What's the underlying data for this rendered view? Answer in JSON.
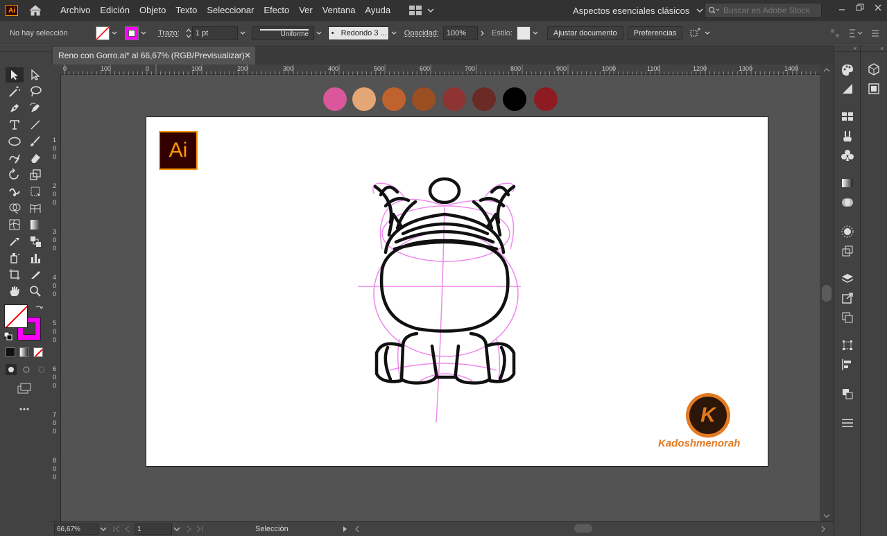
{
  "app": {
    "logo_text": "Ai"
  },
  "menu": [
    "Archivo",
    "Edición",
    "Objeto",
    "Texto",
    "Seleccionar",
    "Efecto",
    "Ver",
    "Ventana",
    "Ayuda"
  ],
  "workspace": "Aspectos esenciales clásicos",
  "stock_search": {
    "placeholder": "Buscar en Adobe Stock"
  },
  "controlbar": {
    "selection": "No hay selección",
    "stroke_label": "Trazo:",
    "stroke_weight": "1 pt",
    "profile": "Uniforme",
    "brush": "Redondo 3 ...",
    "opacity_label": "Opacidad:",
    "opacity_value": "100%",
    "style_label": "Estilo:",
    "adjust_doc": "Ajustar documento",
    "preferences": "Preferencias",
    "fill_color": "#ff00ff",
    "stroke_color": "#ff00ff"
  },
  "document": {
    "tab_title": "Reno con Gorro.ai* al 66,67% (RGB/Previsualizar)",
    "close": "✕"
  },
  "ruler_h": [
    "0",
    "100",
    "0",
    "100",
    "200",
    "300",
    "400",
    "500",
    "600",
    "700",
    "800",
    "900",
    "1000",
    "1100",
    "1200",
    "1300",
    "1400"
  ],
  "ruler_v": [
    "1",
    "0",
    "0",
    "2",
    "0",
    "0",
    "3",
    "0",
    "0",
    "4",
    "0",
    "0",
    "5",
    "0",
    "0",
    "6",
    "0",
    "0",
    "7",
    "0",
    "0",
    "8",
    "0",
    "0"
  ],
  "palette": [
    "#d9579a",
    "#e4a675",
    "#c0622d",
    "#9a4e22",
    "#8e3434",
    "#6b2a25",
    "#000000",
    "#8e1b22"
  ],
  "artboard_logo": "Ai",
  "watermark": {
    "initial": "K",
    "text": "Kadoshmenorah"
  },
  "statusbar": {
    "zoom": "66,67%",
    "artboard": "1",
    "tool": "Selección"
  }
}
